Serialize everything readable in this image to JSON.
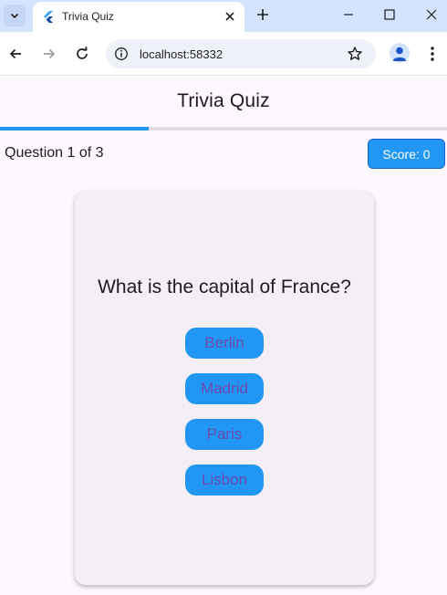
{
  "browser": {
    "tab_title": "Trivia Quiz",
    "url": "localhost:58332",
    "accent": "#d3e3fd"
  },
  "app": {
    "title": "Trivia Quiz",
    "progress": 0.333,
    "progress_color": "#2196f3",
    "question_counter": "Question 1 of 3",
    "score_label": "Score: 0",
    "question": "What is the capital of France?",
    "answers": [
      "Berlin",
      "Madrid",
      "Paris",
      "Lisbon"
    ],
    "answer_button_color": "#2196f3",
    "answer_text_color": "#6a4cae"
  }
}
